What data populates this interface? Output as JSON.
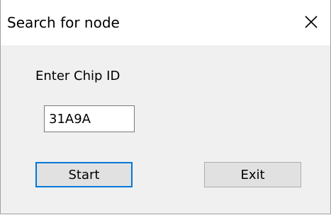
{
  "window": {
    "title": "Search for node"
  },
  "form": {
    "chip_label": "Enter Chip ID",
    "chip_value": "31A9A"
  },
  "buttons": {
    "start_label": "Start",
    "exit_label": "Exit"
  },
  "icons": {
    "close": "close-icon"
  },
  "colors": {
    "dialog_bg": "#f0f0f0",
    "titlebar_bg": "#ffffff",
    "focus_border": "#0078d7",
    "button_bg": "#e1e1e1"
  }
}
